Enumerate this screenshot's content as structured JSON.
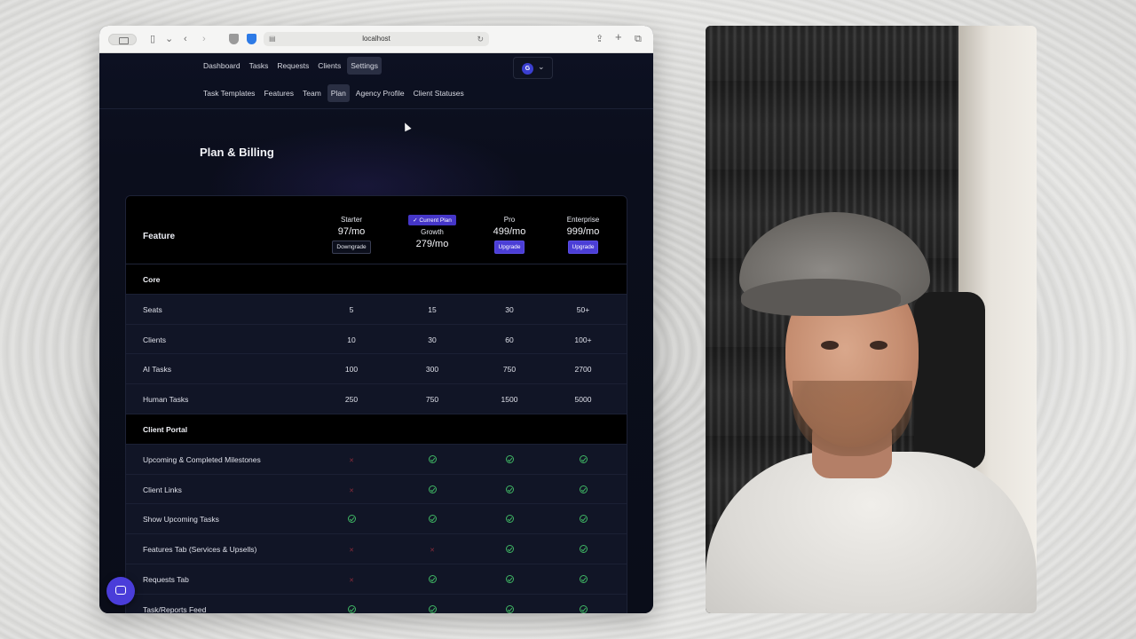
{
  "browser": {
    "url": "localhost"
  },
  "nav": {
    "primary": [
      "Dashboard",
      "Tasks",
      "Requests",
      "Clients",
      "Settings"
    ],
    "primary_active": "Settings",
    "secondary": [
      "Task Templates",
      "Features",
      "Team",
      "Plan",
      "Agency Profile",
      "Client Statuses"
    ],
    "secondary_active": "Plan",
    "user_initial": "G"
  },
  "page": {
    "title": "Plan & Billing"
  },
  "plans": {
    "feature_header": "Feature",
    "columns": [
      {
        "name": "Starter",
        "price": "97/mo",
        "button": "Downgrade",
        "badge": ""
      },
      {
        "name": "Growth",
        "price": "279/mo",
        "button": "",
        "badge": "✓ Current Plan"
      },
      {
        "name": "Pro",
        "price": "499/mo",
        "button": "Upgrade",
        "badge": ""
      },
      {
        "name": "Enterprise",
        "price": "999/mo",
        "button": "Upgrade",
        "badge": ""
      }
    ]
  },
  "sections": [
    {
      "name": "Core",
      "rows": [
        {
          "label": "Seats",
          "values": [
            "5",
            "15",
            "30",
            "50+"
          ]
        },
        {
          "label": "Clients",
          "values": [
            "10",
            "30",
            "60",
            "100+"
          ]
        },
        {
          "label": "AI Tasks",
          "values": [
            "100",
            "300",
            "750",
            "2700"
          ]
        },
        {
          "label": "Human Tasks",
          "values": [
            "250",
            "750",
            "1500",
            "5000"
          ]
        }
      ]
    },
    {
      "name": "Client Portal",
      "rows": [
        {
          "label": "Upcoming & Completed Milestones",
          "values": [
            "cross",
            "check",
            "check",
            "check"
          ]
        },
        {
          "label": "Client Links",
          "values": [
            "cross",
            "check",
            "check",
            "check"
          ]
        },
        {
          "label": "Show Upcoming Tasks",
          "values": [
            "check",
            "check",
            "check",
            "check"
          ]
        },
        {
          "label": "Features Tab (Services & Upsells)",
          "values": [
            "cross",
            "cross",
            "check",
            "check"
          ]
        },
        {
          "label": "Requests Tab",
          "values": [
            "cross",
            "check",
            "check",
            "check"
          ]
        },
        {
          "label": "Task/Reports Feed",
          "values": [
            "check",
            "check",
            "check",
            "check"
          ]
        }
      ]
    }
  ],
  "colors": {
    "accent": "#4b3ed6",
    "check": "#3fb664",
    "cross": "#8b2b3a",
    "page_bg": "#0b0e1c"
  },
  "icons": {
    "chat": "chat-bubble-icon",
    "check": "check-circle-icon",
    "cross": "x-icon"
  }
}
